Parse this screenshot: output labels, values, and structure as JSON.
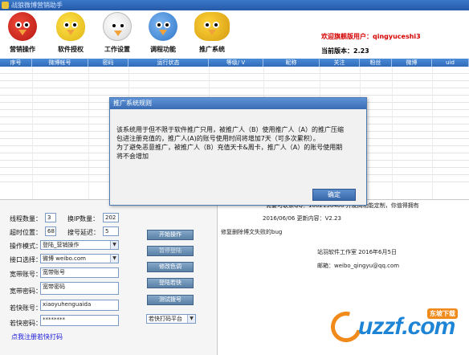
{
  "window": {
    "title": "战狼微博营销助手"
  },
  "toolbar": {
    "items": [
      {
        "label": "营销操作",
        "icon": "red-bird-icon"
      },
      {
        "label": "软件授权",
        "icon": "yellow-bird-icon"
      },
      {
        "label": "工作设置",
        "icon": "white-bird-icon"
      },
      {
        "label": "调程功能",
        "icon": "blue-bird-icon"
      },
      {
        "label": "推广系统",
        "icon": "big-yellow-bird-icon"
      }
    ],
    "welcome_prefix": "欢迎旗舰版用户：",
    "welcome_user": "qingyuceshi3",
    "version_label": "当前版本：2.23"
  },
  "grid": {
    "columns": [
      "序号",
      "微博帐号",
      "密码",
      "运行状态",
      "等级/ V",
      "昵称",
      "关注",
      "粉丝",
      "微博",
      "uid"
    ]
  },
  "left_panel": {
    "thread_label": "线程数量：",
    "thread_value": "3",
    "ip_label": "换IP数量：",
    "ip_value": "202",
    "timeout_label": "超时位置：",
    "timeout_value": "68",
    "interval_label": "搜号延迟：",
    "interval_value": "5",
    "mode_label": "操作模式：",
    "mode_value": "登陆_营销操作",
    "interface_label": "接口选择：",
    "interface_value": "微博 weibo.com",
    "account_label": "宽带账号：",
    "account_value": "宽带账号",
    "password_label": "宽带密码：",
    "password_value": "宽带密码",
    "captcha_user_label": "若快账号：",
    "captcha_user_value": "xiaoyuhenguaida",
    "captcha_pass_label": "若快密码：",
    "captcha_pass_value": "********",
    "captcha_platform_value": "若快打码平台",
    "register_link": "点我注册若快打码",
    "buttons": [
      "开始操作",
      "暂停登陆",
      "修改色调",
      "登陆若快",
      "测试拨号"
    ]
  },
  "log": {
    "line1": "需要可联系QQ：1062136400 开发高功能定制，你值得拥有",
    "line2": "2016/06/06 更新内容：V2.23",
    "line3": "修复删除博文失败的bug",
    "line4": "站羽软件工作室 2016年6月5日",
    "line5": "邮箱：weibo_qingyu@qq.com"
  },
  "dialog": {
    "title": "推广系统规则",
    "line1": "该系统用于但不限于软件推广只用，被推广人（B）使用推广人（A）的推广压缩",
    "line2": "包进注册充值的，推广人(A)的账号使用时间将增加7天（可多次累积）。",
    "line3": "为了避免恶意推广，被推广人（B）充值天卡&周卡，推广人（A）的账号使用期",
    "line4": "将不会增加",
    "ok": "确定"
  },
  "watermark": {
    "text": "uzzf.com",
    "badge": "东坡下载"
  }
}
